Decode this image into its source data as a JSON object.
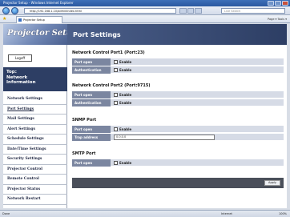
{
  "browser": {
    "window_title": "Projector Setup - Windows Internet Explorer",
    "address": "http://192.168.1.10/adminIndex.html",
    "search_placeholder": "Live Search",
    "tab_title": "Projector Setup",
    "tools": "Page ▾  Tools ▾"
  },
  "sidebar": {
    "logo": "Projector Setup",
    "logoff": "Logoff",
    "top_label": "Top:\nNetwork\nInformation",
    "items": [
      {
        "label": "Network Settings"
      },
      {
        "label": "Port Settings"
      },
      {
        "label": "Mail Settings"
      },
      {
        "label": "Alert Settings"
      },
      {
        "label": "Schedule Settings"
      },
      {
        "label": "Date/Time Settings"
      },
      {
        "label": "Security Settings"
      },
      {
        "label": "Projector Control"
      },
      {
        "label": "Remote Control"
      },
      {
        "label": "Projector Status"
      },
      {
        "label": "Network Restart"
      }
    ]
  },
  "main": {
    "title": "Port Settings",
    "sections": [
      {
        "title": "Network Control Port1 (Port:23)",
        "rows": [
          {
            "label": "Port open",
            "checkbox": "Enable"
          },
          {
            "label": "Authentication",
            "checkbox": "Enable"
          }
        ]
      },
      {
        "title": "Network Control Port2 (Port:9715)",
        "rows": [
          {
            "label": "Port open",
            "checkbox": "Enable"
          },
          {
            "label": "Authentication",
            "checkbox": "Enable"
          }
        ]
      },
      {
        "title": "SNMP Port",
        "rows": [
          {
            "label": "Port open",
            "checkbox": "Enable"
          },
          {
            "label": "Trap address",
            "value": "0.0.0.0"
          }
        ]
      },
      {
        "title": "SMTP Port",
        "rows": [
          {
            "label": "Port open",
            "checkbox": "Enable"
          }
        ]
      }
    ],
    "apply": "Apply"
  },
  "status": {
    "left": "Done",
    "zone": "Internet",
    "zoom": "100%"
  }
}
